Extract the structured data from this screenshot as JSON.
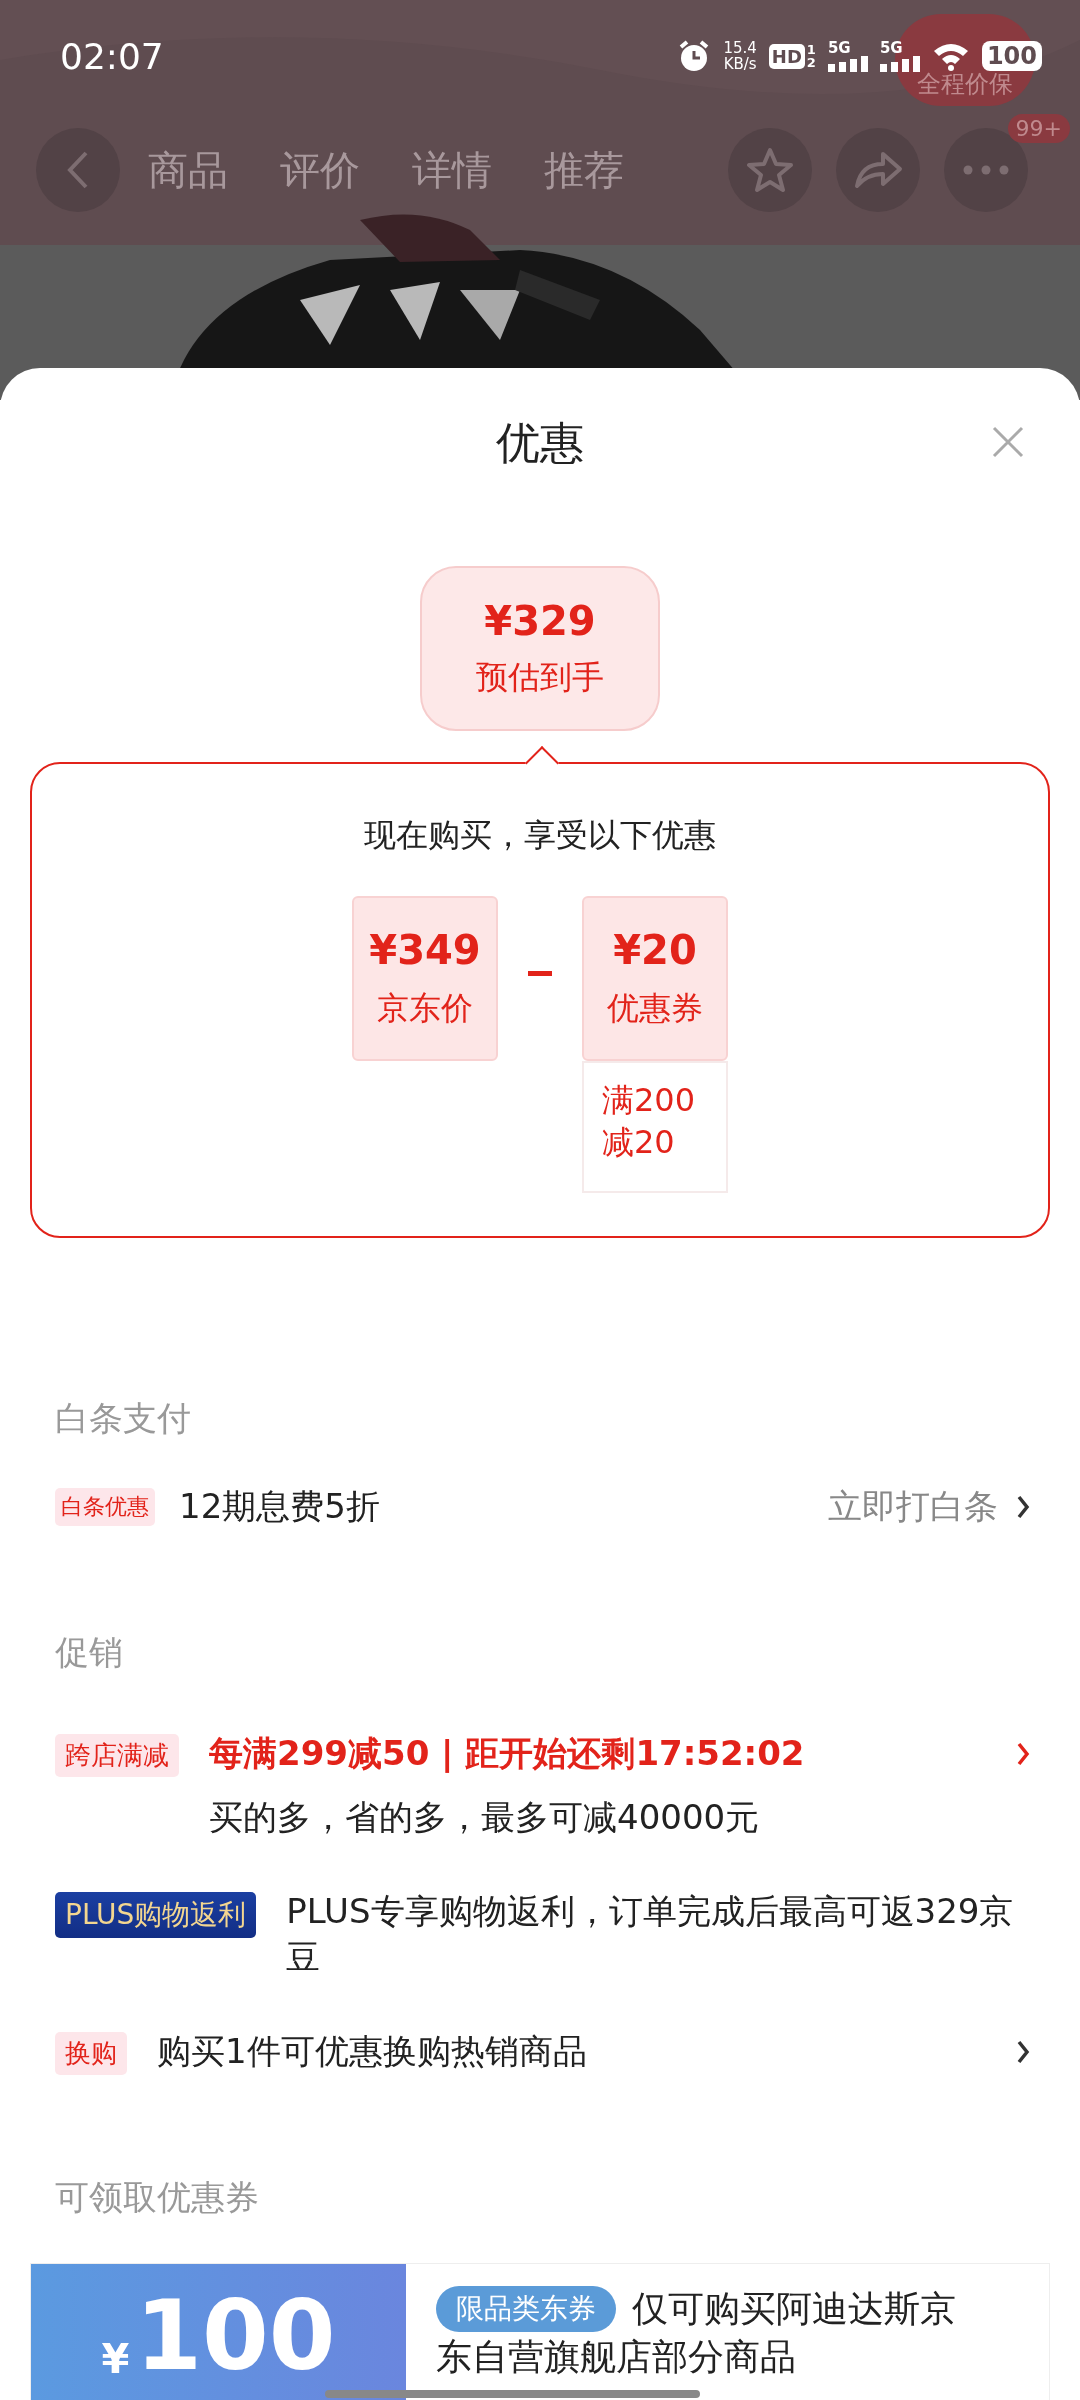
{
  "status_bar": {
    "time": "02:07",
    "speed_value": "15.4",
    "speed_unit": "KB/s",
    "hd_label": "HD",
    "sim_labels": [
      "1",
      "2"
    ],
    "networks": [
      "5G",
      "5G"
    ],
    "battery": "100"
  },
  "price_protect_badge": "全程价保",
  "nav": {
    "tabs": [
      {
        "label": "商品"
      },
      {
        "label": "评价"
      },
      {
        "label": "详情"
      },
      {
        "label": "推荐"
      }
    ],
    "more_badge": "99+"
  },
  "sheet": {
    "title": "优惠",
    "estimate": {
      "price": "¥329",
      "label": "预估到手"
    },
    "breakdown": {
      "heading": "现在购买，享受以下优惠",
      "price": {
        "amount": "¥349",
        "label": "京东价"
      },
      "coupon": {
        "amount": "¥20",
        "label": "优惠券",
        "condition": "满200减20"
      }
    },
    "baitiao": {
      "heading": "白条支付",
      "tag": "白条优惠",
      "text": "12期息费5折",
      "action": "立即打白条"
    },
    "promotions": {
      "heading": "促销",
      "items": [
        {
          "kind": "highlight",
          "tag": "跨店满减",
          "title": "每满299减50 | 距开始还剩17:52:02",
          "subtitle": "买的多，省的多，最多可减40000元",
          "arrow": true
        },
        {
          "kind": "plus",
          "tag": "PLUS购物返利",
          "title": "PLUS专享购物返利，订单完成后最高可返329京豆",
          "arrow": false
        },
        {
          "kind": "normal",
          "tag": "换购",
          "title": "购买1件可优惠换购热销商品",
          "arrow": true
        }
      ]
    },
    "coupons": {
      "heading": "可领取优惠券",
      "items": [
        {
          "currency": "¥",
          "amount": "100",
          "tag": "限品类东券",
          "desc_lines": [
            "仅可购买阿迪达斯京",
            "东自营旗舰店部分商品"
          ]
        }
      ]
    }
  }
}
